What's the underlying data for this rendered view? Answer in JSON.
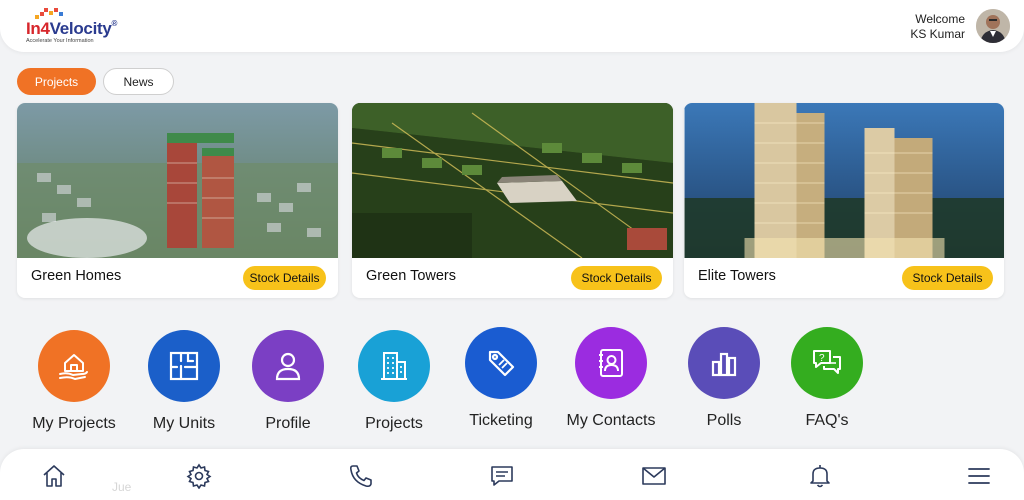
{
  "header": {
    "logo_text_a": "In",
    "logo_text_num": "4",
    "logo_text_b": "Velocity",
    "logo_registered": "®",
    "logo_tagline": "Accelerate Your Information",
    "welcome_label": "Welcome",
    "user_name": "KS Kumar"
  },
  "tabs": [
    {
      "label": "Projects",
      "active": true
    },
    {
      "label": "News",
      "active": false
    }
  ],
  "cards": [
    {
      "title": "Green Homes",
      "button": "Stock Details"
    },
    {
      "title": "Green Towers",
      "button": "Stock Details"
    },
    {
      "title": "Elite Towers",
      "button": "Stock Details"
    }
  ],
  "menu": [
    {
      "label": "My Projects",
      "icon": "house-hand-icon",
      "color": "#f07225"
    },
    {
      "label": "My Units",
      "icon": "floorplan-icon",
      "color": "#1b5fc9"
    },
    {
      "label": "Profile",
      "icon": "person-icon",
      "color": "#7b3fc4"
    },
    {
      "label": "Projects",
      "icon": "buildings-icon",
      "color": "#19a1d6"
    },
    {
      "label": "Ticketing",
      "icon": "tag-icon",
      "color": "#1a5cd1"
    },
    {
      "label": "My Contacts",
      "icon": "contact-book-icon",
      "color": "#9b2ce0"
    },
    {
      "label": "Polls",
      "icon": "bar-chart-icon",
      "color": "#5a4db8"
    },
    {
      "label": "FAQ's",
      "icon": "chat-question-icon",
      "color": "#34ad1f"
    }
  ],
  "bottom_nav": {
    "ghost_text": "Jue",
    "items": [
      "home-icon",
      "settings-icon",
      "phone-icon",
      "message-icon",
      "mail-icon",
      "bell-icon",
      "menu-icon"
    ]
  },
  "colors": {
    "accent": "#f07225",
    "button_yellow": "#f7c21a"
  }
}
